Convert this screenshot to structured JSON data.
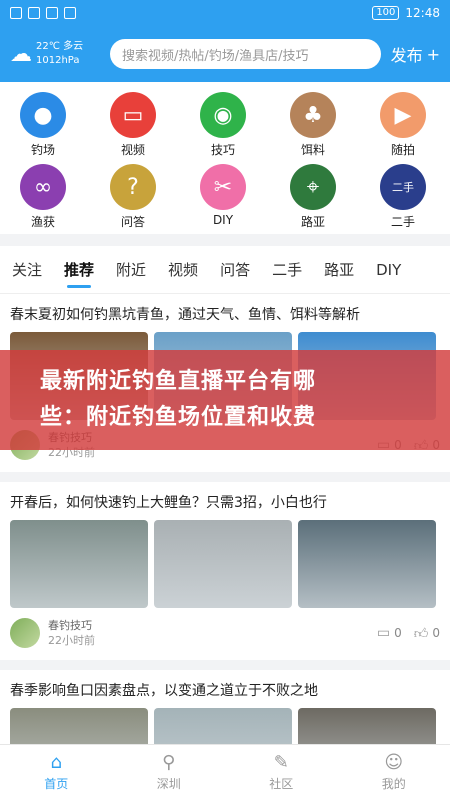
{
  "status": {
    "time": "12:48",
    "battery": "100"
  },
  "header": {
    "weather_line1": "22℃ 多云",
    "weather_line2": "1012hPa",
    "search_placeholder": "搜索视频/热帖/钓场/渔具店/技巧",
    "publish_label": "发布",
    "publish_plus": "+"
  },
  "categories": [
    {
      "label": "钓场",
      "icon": "location-pin-icon",
      "color": "#2b8be6",
      "glyph": "●"
    },
    {
      "label": "视频",
      "icon": "tv-icon",
      "color": "#e8403a",
      "glyph": "▭"
    },
    {
      "label": "技巧",
      "icon": "eye-icon",
      "color": "#2fb34a",
      "glyph": "◉"
    },
    {
      "label": "饵料",
      "icon": "acorn-icon",
      "color": "#b5835a",
      "glyph": "♣"
    },
    {
      "label": "随拍",
      "icon": "play-icon",
      "color": "#f29b6b",
      "glyph": "▶"
    },
    {
      "label": "渔获",
      "icon": "fish-icon",
      "color": "#8b3fb0",
      "glyph": "∞"
    },
    {
      "label": "问答",
      "icon": "question-icon",
      "color": "#c8a33b",
      "glyph": "?"
    },
    {
      "label": "DIY",
      "icon": "scissors-icon",
      "color": "#f06fa8",
      "glyph": "✂"
    },
    {
      "label": "路亚",
      "icon": "map-pin-icon",
      "color": "#2f7a3d",
      "glyph": "⌖"
    },
    {
      "label": "二手",
      "icon": "second-hand-icon",
      "color": "#2a3e8c",
      "glyph": "二手"
    }
  ],
  "tabs": [
    "关注",
    "推荐",
    "附近",
    "视频",
    "问答",
    "二手",
    "路亚",
    "DIY"
  ],
  "active_tab": "推荐",
  "posts": [
    {
      "title": "春末夏初如何钓黑坑青鱼，通过天气、鱼情、饵料等解析",
      "author": "春钓技巧",
      "time": "22小时前",
      "comments": "0",
      "likes": "0",
      "images": [
        "#7b5a3a",
        "#6aa0c8",
        "#3e8cd0"
      ]
    },
    {
      "title": "开春后，如何快速钓上大鲤鱼？只需3招，小白也行",
      "author": "春钓技巧",
      "time": "22小时前",
      "comments": "0",
      "likes": "0",
      "images": [
        "#7f8f8c",
        "#a9b0b3",
        "#5b6f7a"
      ]
    },
    {
      "title": "春季影响鱼口因素盘点，以变通之道立于不败之地",
      "author": "",
      "time": "",
      "comments": "",
      "likes": "",
      "images": [
        "#8a8d7e",
        "#a4b3b8",
        "#6d6a62"
      ]
    }
  ],
  "overlay": {
    "line1": "最新附近钓鱼直播平台有哪",
    "line2": "些：附近钓鱼场位置和收费"
  },
  "bottom_nav": [
    {
      "label": "首页",
      "icon": "home-icon",
      "glyph": "⌂"
    },
    {
      "label": "深圳",
      "icon": "location-icon",
      "glyph": "⚲"
    },
    {
      "label": "社区",
      "icon": "edit-icon",
      "glyph": "✎"
    },
    {
      "label": "我的",
      "icon": "user-icon",
      "glyph": "☺"
    }
  ],
  "active_nav": "首页",
  "colors": {
    "accent": "#2ea0f0"
  }
}
